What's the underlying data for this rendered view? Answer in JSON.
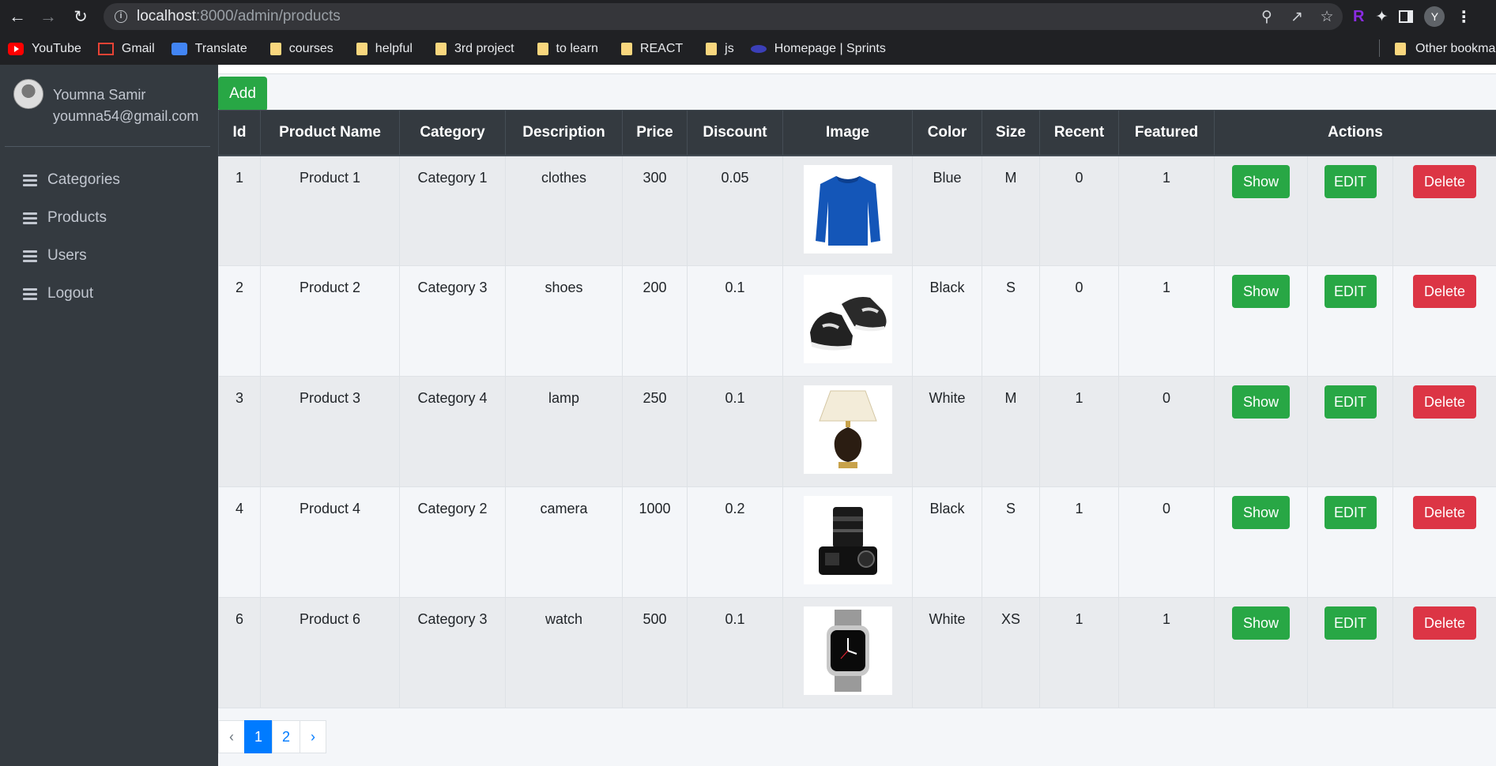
{
  "browser": {
    "url_host": "localhost",
    "url_path": ":8000/admin/products",
    "profile_initial": "Y",
    "bookmarks": [
      {
        "label": "YouTube",
        "icon": "youtube-icon"
      },
      {
        "label": "Gmail",
        "icon": "gmail-icon"
      },
      {
        "label": "Translate",
        "icon": "translate-icon"
      },
      {
        "label": "courses",
        "icon": "folder-icon"
      },
      {
        "label": "helpful",
        "icon": "folder-icon"
      },
      {
        "label": "3rd project",
        "icon": "folder-icon"
      },
      {
        "label": "to learn",
        "icon": "folder-icon"
      },
      {
        "label": "REACT",
        "icon": "folder-icon"
      },
      {
        "label": "js",
        "icon": "folder-icon"
      },
      {
        "label": "Homepage | Sprints",
        "icon": "sprints-icon"
      }
    ],
    "other_bookmarks": "Other bookmarks"
  },
  "user": {
    "name": "Youmna Samir",
    "email": "youmna54@gmail.com"
  },
  "sidebar": {
    "items": [
      {
        "label": "Categories"
      },
      {
        "label": "Products"
      },
      {
        "label": "Users"
      },
      {
        "label": "Logout"
      }
    ]
  },
  "main": {
    "add_label": "Add",
    "columns": [
      "Id",
      "Product Name",
      "Category",
      "Description",
      "Price",
      "Discount",
      "Image",
      "Color",
      "Size",
      "Recent",
      "Featured",
      "Actions"
    ],
    "rows": [
      {
        "id": "1",
        "name": "Product 1",
        "category": "Category 1",
        "description": "clothes",
        "price": "300",
        "discount": "0.05",
        "image": "sweater-image",
        "color": "Blue",
        "size": "M",
        "recent": "0",
        "featured": "1"
      },
      {
        "id": "2",
        "name": "Product 2",
        "category": "Category 3",
        "description": "shoes",
        "price": "200",
        "discount": "0.1",
        "image": "shoes-image",
        "color": "Black",
        "size": "S",
        "recent": "0",
        "featured": "1"
      },
      {
        "id": "3",
        "name": "Product 3",
        "category": "Category 4",
        "description": "lamp",
        "price": "250",
        "discount": "0.1",
        "image": "lamp-image",
        "color": "White",
        "size": "M",
        "recent": "1",
        "featured": "0"
      },
      {
        "id": "4",
        "name": "Product 4",
        "category": "Category 2",
        "description": "camera",
        "price": "1000",
        "discount": "0.2",
        "image": "camera-image",
        "color": "Black",
        "size": "S",
        "recent": "1",
        "featured": "0"
      },
      {
        "id": "6",
        "name": "Product 6",
        "category": "Category 3",
        "description": "watch",
        "price": "500",
        "discount": "0.1",
        "image": "watch-image",
        "color": "White",
        "size": "XS",
        "recent": "1",
        "featured": "1"
      }
    ],
    "actions": {
      "show": "Show",
      "edit": "EDIT",
      "delete": "Delete"
    },
    "pagination": {
      "prev": "‹",
      "pages": [
        "1",
        "2"
      ],
      "active": "1",
      "next": "›"
    }
  },
  "colors": {
    "sidebar_bg": "#343a40",
    "success": "#28a745",
    "danger": "#dc3545",
    "primary": "#007bff"
  }
}
